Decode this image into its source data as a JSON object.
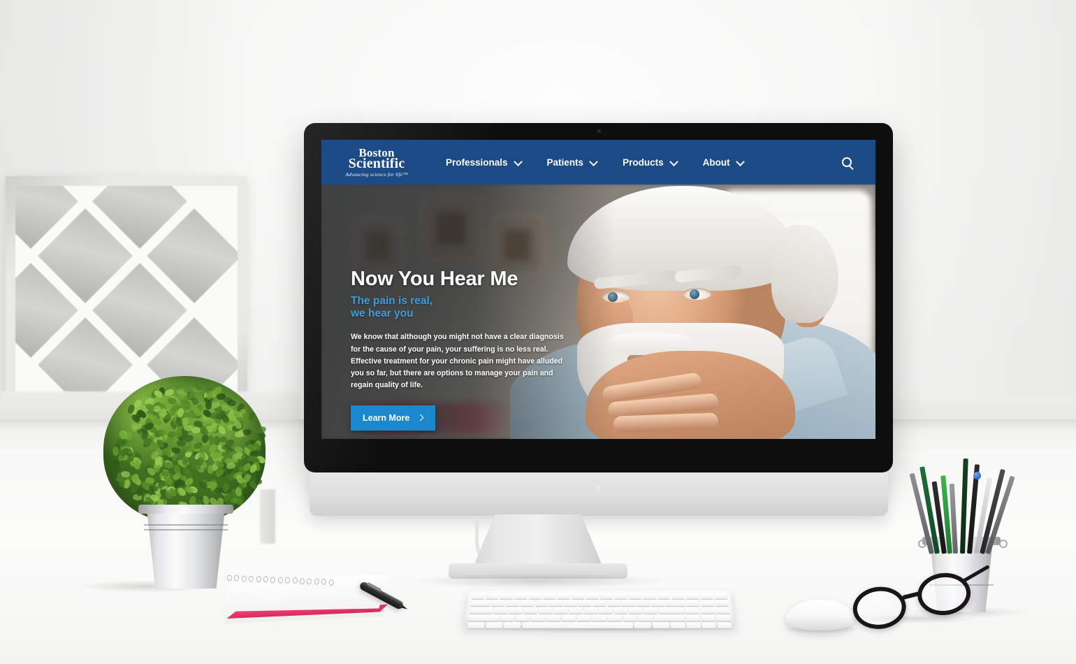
{
  "scene": {
    "description": "Desktop computer mockup on a white desk showing a Boston Scientific website homepage",
    "wall_color": "#f7f7f6",
    "desk_color": "#fbfbfa"
  },
  "website": {
    "navbar": {
      "background_color": "#1b4a85",
      "logo": {
        "line1": "Boston",
        "line2": "Scientific",
        "tagline": "Advancing science for life™"
      },
      "items": [
        {
          "label": "Professionals",
          "has_dropdown": true,
          "icon": "chevron-down-icon"
        },
        {
          "label": "Patients",
          "has_dropdown": true,
          "icon": "chevron-down-icon"
        },
        {
          "label": "Products",
          "has_dropdown": true,
          "icon": "chevron-down-icon"
        },
        {
          "label": "About",
          "has_dropdown": true,
          "icon": "chevron-down-icon"
        }
      ],
      "search": {
        "icon": "search-icon",
        "label": "Search"
      }
    },
    "hero": {
      "heading": "Now You Hear Me",
      "subheading_line1": "The pain is real,",
      "subheading_line2": "we hear you",
      "subheading_color": "#3f9ed8",
      "body": "We know that although you might not have a clear diagnosis for the cause of your pain, your suffering is no less real. Effective treatment for your chronic pain might have alluded you so far, but there are options to manage your pain and regain quality of life.",
      "cta": {
        "label": "Learn More",
        "icon": "chevron-right-icon",
        "background_color": "#1b87cc"
      },
      "image_alt": "Elderly man with white hair and beard resting chin on clasped hands, looking thoughtful"
    }
  },
  "desk_objects": [
    {
      "name": "monitor",
      "type": "all-in-one desktop computer",
      "bezel_color": "#0e0e0f",
      "body_color": "#e7e7e6"
    },
    {
      "name": "keyboard",
      "type": "white slim keyboard"
    },
    {
      "name": "mouse",
      "type": "white wireless mouse"
    },
    {
      "name": "potted-plant",
      "type": "round topiary in galvanized metal pot"
    },
    {
      "name": "notebook",
      "type": "spiral notebook with pink edge"
    },
    {
      "name": "pen",
      "type": "black ballpoint pen"
    },
    {
      "name": "pencil-cup",
      "type": "galvanized metal cup with pens and pencils"
    },
    {
      "name": "eyeglasses",
      "type": "black framed eyeglasses"
    },
    {
      "name": "wall-art",
      "type": "distressed white frame with gray diamond harlequin pattern"
    }
  ]
}
